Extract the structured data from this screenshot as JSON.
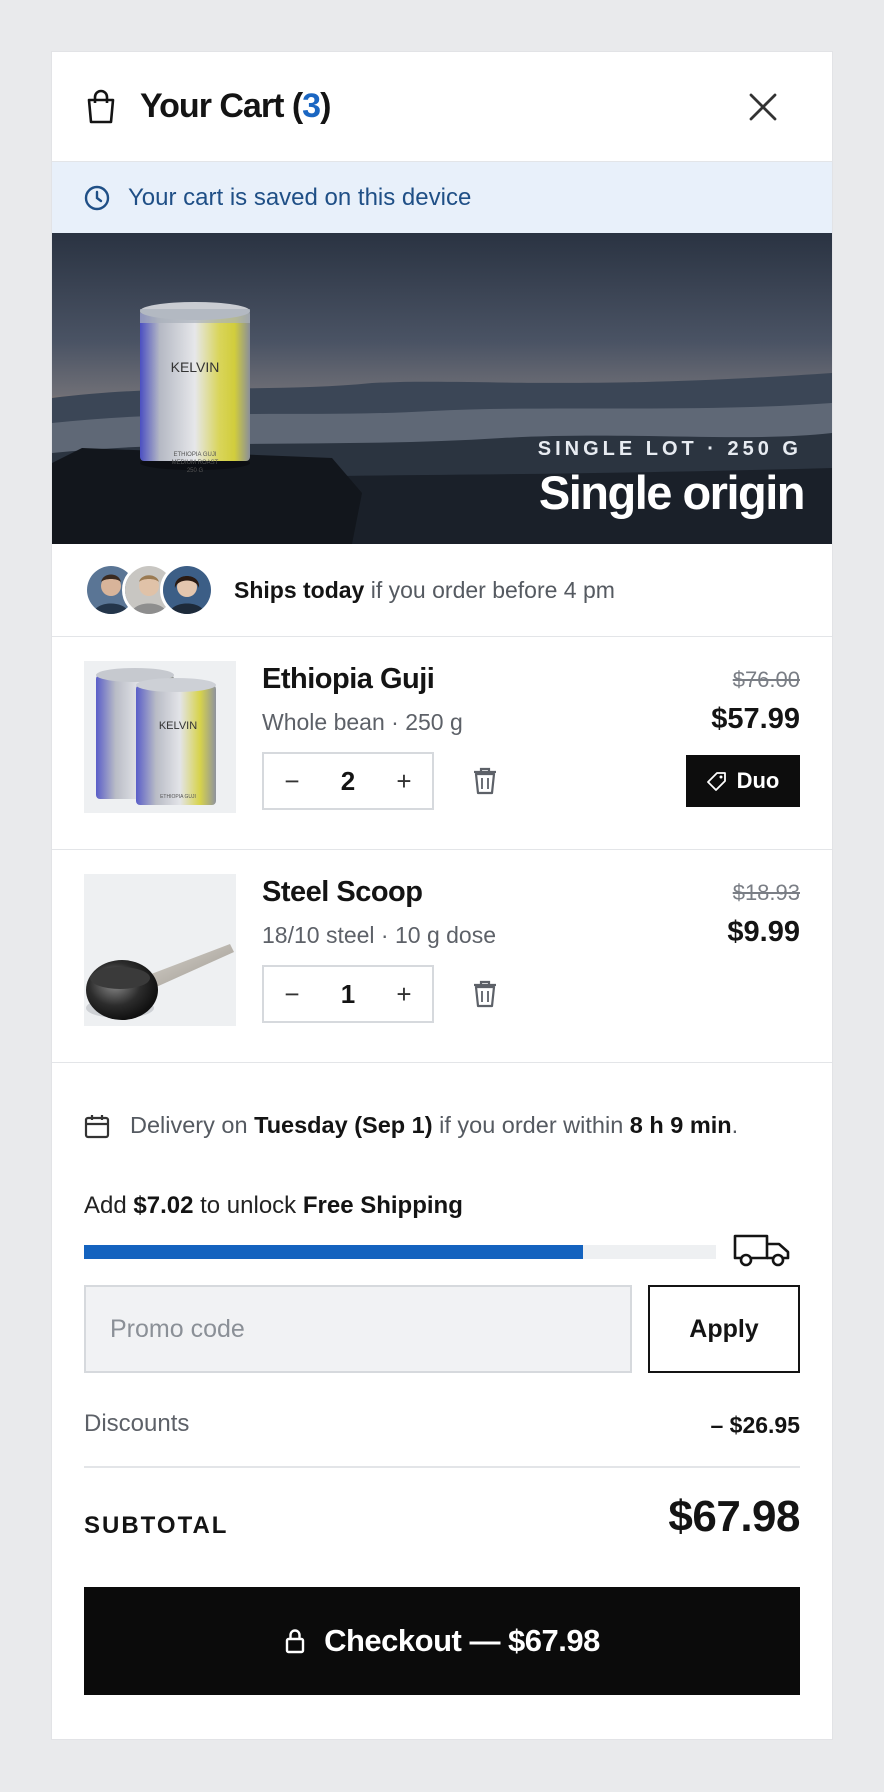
{
  "header": {
    "title": "Your Cart",
    "count_open": "(",
    "count": "3",
    "count_close": ")",
    "accent_color": "#1a66c2"
  },
  "saved_banner": {
    "text": "Your cart is saved on this device"
  },
  "hero": {
    "eyebrow": "SINGLE LOT · 250 G",
    "headline": "Single origin",
    "can_brand": "KELVIN",
    "can_lines": [
      "ETHIOPIA GUJI",
      "MEDIUM ROAST",
      "250 G"
    ]
  },
  "ships": {
    "bold": "Ships today",
    "rest": " if you order before 4 pm"
  },
  "items": [
    {
      "name": "Ethiopia Guji",
      "variant": "Whole bean · 250 g",
      "quantity": "2",
      "old_price": "$76.00",
      "price": "$57.99",
      "badge": "Duo",
      "minus": "−",
      "plus": "+"
    },
    {
      "name": "Steel Scoop",
      "variant": "18/10 steel · 10 g dose",
      "quantity": "1",
      "old_price": "$18.93",
      "price": "$9.99",
      "minus": "−",
      "plus": "+"
    }
  ],
  "delivery": {
    "pre": "Delivery on ",
    "day": "Tuesday (Sep 1)",
    "mid": " if you order within ",
    "time": "8 h 9 min",
    "post": "."
  },
  "shipping": {
    "pre": "Add ",
    "amount": "$7.02",
    "mid": " to unlock ",
    "goal": "Free Shipping",
    "progress": 0.79,
    "bar_color": "#1463bf"
  },
  "promo": {
    "placeholder": "Promo code",
    "apply_label": "Apply"
  },
  "discounts": {
    "label": "Discounts",
    "value": "– $26.95"
  },
  "subtotal": {
    "label": "SUBTOTAL",
    "value": "$67.98"
  },
  "checkout": {
    "label": "Checkout — $67.98"
  }
}
